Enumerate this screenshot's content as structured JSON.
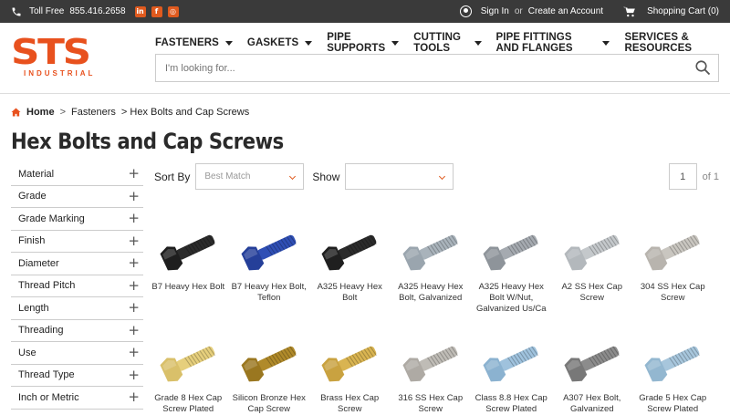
{
  "topbar": {
    "toll_label": "Toll Free",
    "phone": "855.416.2658",
    "social": [
      "in",
      "f",
      "◎"
    ],
    "signin": "Sign In",
    "or": "or",
    "create_account": "Create an Account",
    "cart": "Shopping Cart (0)"
  },
  "logo": {
    "main": "STS",
    "sub": "INDUSTRIAL"
  },
  "nav": {
    "items": [
      {
        "label": "FASTENERS",
        "dropdown": true
      },
      {
        "label": "GASKETS",
        "dropdown": true
      },
      {
        "label": "PIPE SUPPORTS",
        "dropdown": true
      },
      {
        "label": "CUTTING TOOLS",
        "dropdown": true
      },
      {
        "label": "PIPE FITTINGS AND FLANGES",
        "dropdown": true
      },
      {
        "label": "SERVICES & RESOURCES",
        "dropdown": false
      }
    ]
  },
  "search": {
    "placeholder": "I'm looking for..."
  },
  "breadcrumb": {
    "home": "Home",
    "sep": ">",
    "level1": "Fasteners",
    "level2": "> Hex Bolts and Cap Screws"
  },
  "page": {
    "title": "Hex Bolts and Cap Screws"
  },
  "filters": [
    "Material",
    "Grade",
    "Grade Marking",
    "Finish",
    "Diameter",
    "Thread Pitch",
    "Length",
    "Threading",
    "Use",
    "Thread Type",
    "Inch or Metric"
  ],
  "sort": {
    "label": "Sort By",
    "value": "Best Match",
    "show_label": "Show",
    "show_value": ""
  },
  "pager": {
    "current": "1",
    "of": "of 1"
  },
  "products": [
    {
      "name": "B7 Heavy Hex Bolt",
      "color": "#2b2b2b",
      "head": "#1e1e1e"
    },
    {
      "name": "B7 Heavy Hex Bolt, Teflon",
      "color": "#2f4fb5",
      "head": "#253f99"
    },
    {
      "name": "A325 Heavy Hex Bolt",
      "color": "#2b2b2b",
      "head": "#1f1f1f"
    },
    {
      "name": "A325 Heavy Hex Bolt, Galvanized",
      "color": "#a9b3bb",
      "head": "#9aa5ae"
    },
    {
      "name": "A325 Heavy Hex Bolt W/Nut, Galvanized Us/Ca",
      "color": "#a5aab0",
      "head": "#8e949a"
    },
    {
      "name": "A2 SS Hex Cap Screw",
      "color": "#c4c8cb",
      "head": "#b3b8bc"
    },
    {
      "name": "304 SS Hex Cap Screw",
      "color": "#c9c6c0",
      "head": "#b8b4ae"
    },
    {
      "name": "Grade 8 Hex Cap Screw Plated",
      "color": "#e6cf7c",
      "head": "#d9c06a"
    },
    {
      "name": "Silicon Bronze Hex Cap Screw",
      "color": "#b08a2a",
      "head": "#9a7720"
    },
    {
      "name": "Brass Hex Cap Screw",
      "color": "#d9b451",
      "head": "#c9a240"
    },
    {
      "name": "316 SS Hex Cap Screw",
      "color": "#bfbcb6",
      "head": "#aeaaa4"
    },
    {
      "name": "Class 8.8 Hex Cap Screw Plated",
      "color": "#9fc2dd",
      "head": "#8bb2d0"
    },
    {
      "name": "A307 Hex Bolt, Galvanized",
      "color": "#8c8c8c",
      "head": "#787878"
    },
    {
      "name": "Grade 5 Hex Cap Screw Plated",
      "color": "#a7c6dc",
      "head": "#93b7d0"
    }
  ],
  "colors": {
    "accent": "#e8511e",
    "topbar": "#3a3a3a"
  }
}
